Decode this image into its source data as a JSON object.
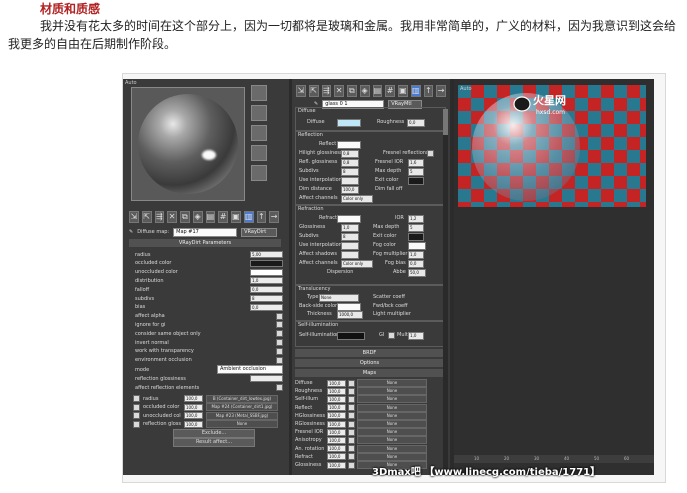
{
  "article": {
    "heading": "材质和质感",
    "paragraph": "我并没有花太多的时间在这个部分上，因为一切都将是玻璃和金属。我用非常简单的，广义的材料，因为我意识到这会给我更多的自由在后期制作阶段。"
  },
  "left_editor": {
    "viewport_tag": "Auto",
    "map_label": "Diffuse map:",
    "map_name": "Map #17",
    "map_type": "VRayDirt",
    "rollout_title": "VRayDirt Parameters",
    "params": [
      {
        "label": "radius",
        "value": "5,00"
      },
      {
        "label": "occluded color",
        "value": ""
      },
      {
        "label": "unoccluded color",
        "value": ""
      },
      {
        "label": "distribution",
        "value": "1,0"
      },
      {
        "label": "falloff",
        "value": "0,0"
      },
      {
        "label": "subdivs",
        "value": "8"
      },
      {
        "label": "bias",
        "value": "0,0"
      },
      {
        "label": "affect alpha",
        "value": ""
      },
      {
        "label": "ignore for gi",
        "value": ""
      },
      {
        "label": "consider same object only",
        "value": ""
      },
      {
        "label": "invert normal",
        "value": ""
      },
      {
        "label": "work with transparency",
        "value": ""
      },
      {
        "label": "environment occlusion",
        "value": ""
      }
    ],
    "mode_label": "mode",
    "mode_value": "Ambient occlusion",
    "reflection_glossiness_label": "reflection glossiness",
    "affect_reflection_elements": "affect reflection elements",
    "map_rows": [
      {
        "label": "radius",
        "value": "100,0",
        "map": "B (Container_dirt_lowtex.jpg)"
      },
      {
        "label": "occluded color",
        "value": "100,0",
        "map": "Map #24 (Container_dirt1.jpg)"
      },
      {
        "label": "unoccluded color",
        "value": "100,0",
        "map": "Map #23 (Metal_SSBF.jpg)"
      },
      {
        "label": "reflection glossiness",
        "value": "100,0",
        "map": "None"
      }
    ],
    "exclude_label": "Exclude...",
    "result_affect_label": "Result affect..."
  },
  "center_editor": {
    "material_name": "glass 0 1",
    "material_type": "VRayMtl",
    "diffuse_section": "Diffuse",
    "diffuse_label": "Diffuse",
    "roughness_label": "Roughness",
    "roughness_value": "0,0",
    "reflection_section": "Reflection",
    "reflect_label": "Reflect",
    "reflection_params": [
      {
        "label": "Hilight glossiness",
        "value": "0,8",
        "extra": "L"
      },
      {
        "label": "Refl. glossiness",
        "value": "0,8",
        "extra": "Fresnel IOR"
      },
      {
        "label": "Subdivs",
        "value": "8",
        "extra": "Max depth"
      },
      {
        "label": "Use interpolation",
        "value": "",
        "extra": "Exit color"
      },
      {
        "label": "Dim distance",
        "value": "100,0",
        "extra": "Dim fall off"
      }
    ],
    "fresnel_label": "Fresnel reflections",
    "fresnel_ior_value": "1,6",
    "max_depth_value": "5",
    "affect_channels_label": "Affect channels",
    "affect_channels_value": "Color only",
    "refraction_section": "Refraction",
    "refract_label": "Refract",
    "ior_label": "IOR",
    "ior_value": "1,2",
    "refraction_params": [
      {
        "label": "Glossiness",
        "value": "1,0",
        "extra": "Max depth"
      },
      {
        "label": "Subdivs",
        "value": "8",
        "extra": "Exit color"
      },
      {
        "label": "Use interpolation",
        "value": "",
        "extra": "Fog color"
      },
      {
        "label": "Affect shadows",
        "value": "",
        "extra": "Fog multiplier"
      }
    ],
    "refr_max_depth_value": "5",
    "fog_multiplier_value": "1,0",
    "fog_bias_label": "Fog bias",
    "fog_bias_value": "0,0",
    "abbe_label": "Abbe",
    "abbe_value": "50,0",
    "dispersion_label": "Dispersion",
    "translucency_section": "Translucency",
    "type_label": "Type",
    "type_value": "None",
    "scatter_coeff_label": "Scatter coeff",
    "back_side_color_label": "Back-side color",
    "fwd_bck_label": "Fwd/bck coeff",
    "thickness_label": "Thickness",
    "thickness_value": "1000,0",
    "light_multiplier_label": "Light multiplier",
    "self_illum_section": "Self-illumination",
    "self_illum_label": "Self-illumination",
    "gi_label": "GI",
    "mult_label": "Mult",
    "mult_value": "1,0",
    "brdf_label": "BRDF",
    "options_label": "Options",
    "maps_label": "Maps",
    "maps": [
      {
        "label": "Diffuse",
        "value": "100,0",
        "map": "None"
      },
      {
        "label": "Roughness",
        "value": "100,0",
        "map": "None"
      },
      {
        "label": "Self-illum",
        "value": "100,0",
        "map": "None"
      },
      {
        "label": "Reflect",
        "value": "100,0",
        "map": "None"
      },
      {
        "label": "HGlossiness",
        "value": "100,0",
        "map": "None"
      },
      {
        "label": "RGlossiness",
        "value": "100,0",
        "map": "None"
      },
      {
        "label": "Fresnel IOR",
        "value": "100,0",
        "map": "None"
      },
      {
        "label": "Anisotropy",
        "value": "100,0",
        "map": "None"
      },
      {
        "label": "An. rotation",
        "value": "100,0",
        "map": "None"
      },
      {
        "label": "Refract",
        "value": "100,0",
        "map": "None"
      },
      {
        "label": "Glossiness",
        "value": "100,0",
        "map": "None"
      }
    ]
  },
  "viewport": {
    "tag": "Auto",
    "logo_text": "火星网",
    "logo_url": "hxsd.com"
  },
  "timeline": {
    "ticks": [
      "10",
      "20",
      "30",
      "40",
      "50",
      "60"
    ]
  },
  "watermark": "3Dmax吧 【www.linecg.com/tieba/1771】",
  "colors": {
    "heading": "#b22222",
    "panel": "#3a3a3a",
    "accent": "#4a7bd0",
    "diffuse_swatch": "#bfe6f6"
  }
}
